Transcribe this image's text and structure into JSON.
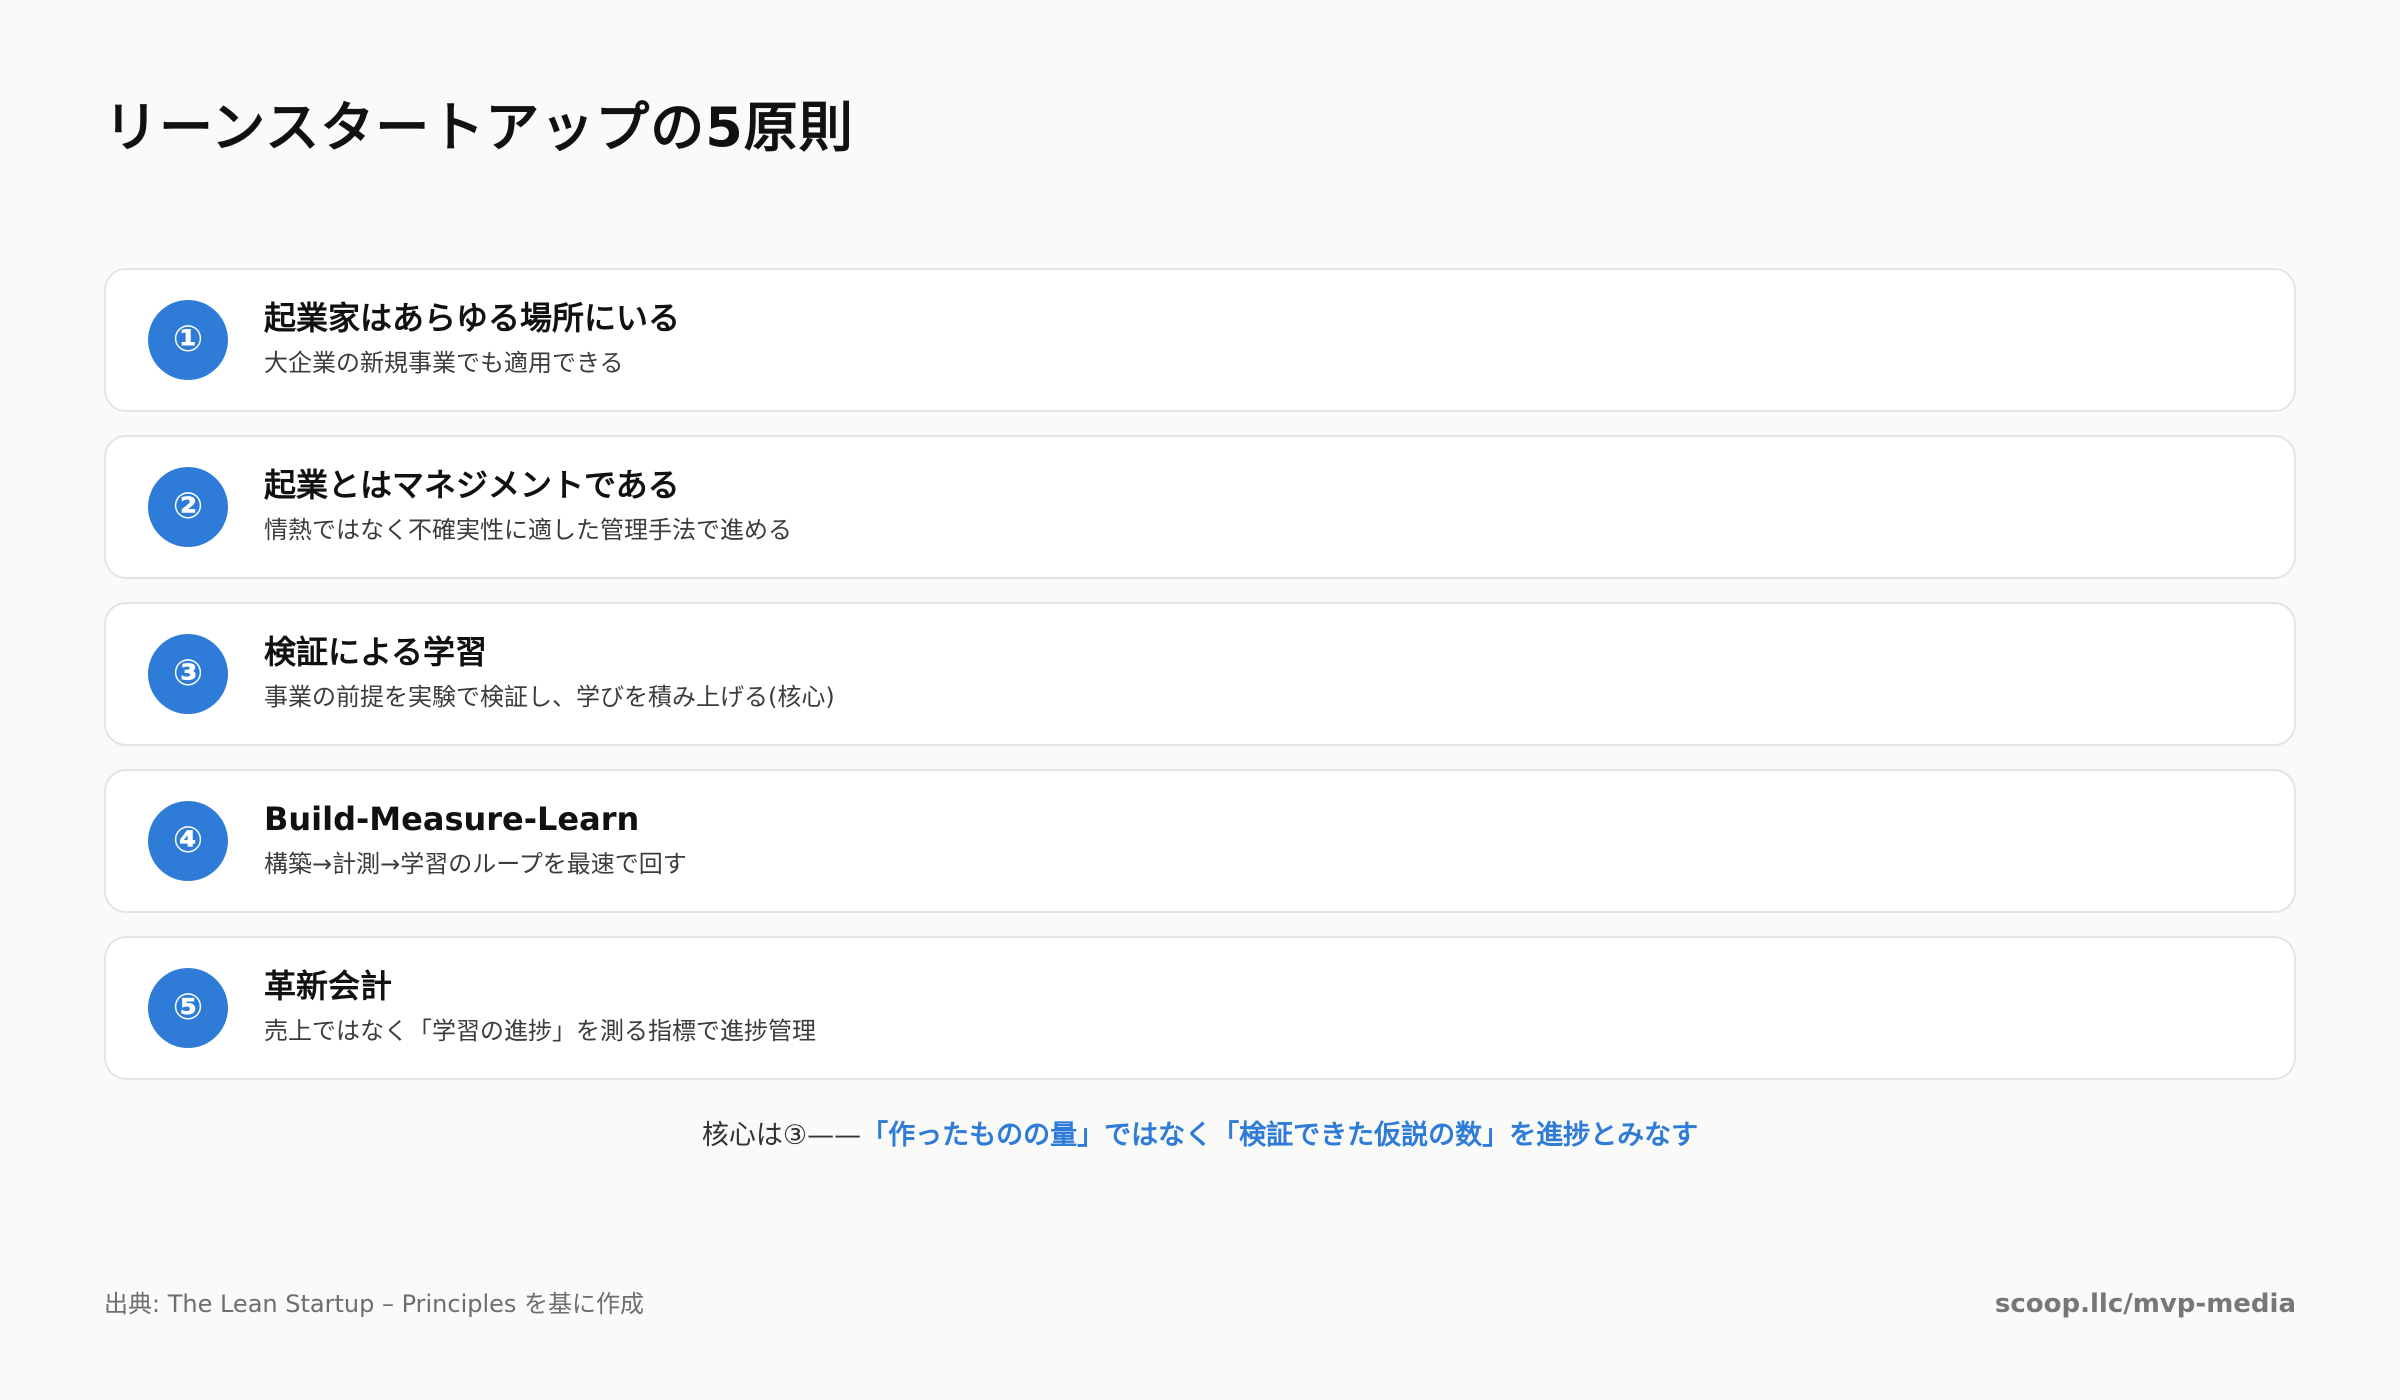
{
  "title": "リーンスタートアップの5原則",
  "colors": {
    "accent": "#2f7bd8",
    "background": "#fafaf8",
    "card_border": "#e4e4e4"
  },
  "principles": [
    {
      "number": "①",
      "title": "起業家はあらゆる場所にいる",
      "description": "大企業の新規事業でも適用できる"
    },
    {
      "number": "②",
      "title": "起業とはマネジメントである",
      "description": "情熱ではなく不確実性に適した管理手法で進める"
    },
    {
      "number": "③",
      "title": "検証による学習",
      "description": "事業の前提を実験で検証し、学びを積み上げる(核心)"
    },
    {
      "number": "④",
      "title": "Build-Measure-Learn",
      "description": "構築→計測→学習のループを最速で回す"
    },
    {
      "number": "⑤",
      "title": "革新会計",
      "description": "売上ではなく「学習の進捗」を測る指標で進捗管理"
    }
  ],
  "summary": {
    "prefix": "核心は③——",
    "emphasis": "「作ったものの量」ではなく「検証できた仮説の数」を進捗とみなす"
  },
  "footer": {
    "source": "出典: The Lean Startup – Principles を基に作成",
    "url": "scoop.llc/mvp-media"
  }
}
